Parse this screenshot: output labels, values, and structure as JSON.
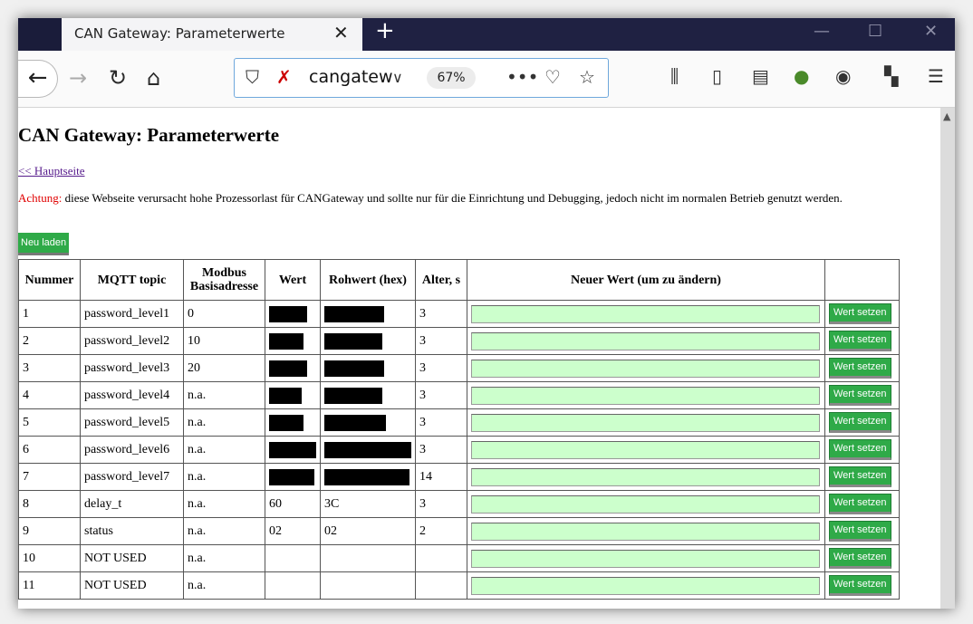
{
  "browser": {
    "tab_title": "CAN Gateway: Parameterwerte",
    "tab_close": "✕",
    "new_tab": "+",
    "url": "cangatew",
    "zoom": "67%",
    "icons": [
      "back-icon",
      "forward-icon",
      "reload-icon",
      "home-icon",
      "shield-icon",
      "tracking-off-icon",
      "dropdown-icon",
      "more-icon",
      "pocket-icon",
      "bookmark-star-icon",
      "library-icon",
      "sidebar-icon",
      "reader-icon",
      "extension-icon",
      "account-icon",
      "gift-icon",
      "menu-icon"
    ]
  },
  "page": {
    "title": "CAN Gateway: Parameterwerte",
    "home_link": "<< Hauptseite",
    "warning_label": "Achtung:",
    "warning_text": " diese Webseite verursacht hohe Prozessorlast für CANGateway und sollte nur für die Einrichtung und Debugging, jedoch nicht im normalen Betrieb genutzt werden.",
    "reload_button": "Neu laden",
    "set_button": "Wert setzen",
    "table": {
      "headers": [
        "Nummer",
        "MQTT topic",
        "Modbus Basisadresse",
        "Wert",
        "Rohwert (hex)",
        "Alter, s",
        "Neuer Wert (um zu ändern)",
        ""
      ],
      "rows": [
        {
          "nr": "1",
          "topic": "password_level1",
          "modbus": "0",
          "wert": "",
          "raw": "",
          "alter": "3",
          "wert_redacted": true,
          "raw_redacted": true
        },
        {
          "nr": "2",
          "topic": "password_level2",
          "modbus": "10",
          "wert": "",
          "raw": "",
          "alter": "3",
          "wert_redacted": true,
          "raw_redacted": true
        },
        {
          "nr": "3",
          "topic": "password_level3",
          "modbus": "20",
          "wert": "",
          "raw": "",
          "alter": "3",
          "wert_redacted": true,
          "raw_redacted": true
        },
        {
          "nr": "4",
          "topic": "password_level4",
          "modbus": "n.a.",
          "wert": "",
          "raw": "",
          "alter": "3",
          "wert_redacted": true,
          "raw_redacted": true
        },
        {
          "nr": "5",
          "topic": "password_level5",
          "modbus": "n.a.",
          "wert": "",
          "raw": "",
          "alter": "3",
          "wert_redacted": true,
          "raw_redacted": true
        },
        {
          "nr": "6",
          "topic": "password_level6",
          "modbus": "n.a.",
          "wert": "",
          "raw": "",
          "alter": "3",
          "wert_redacted": true,
          "raw_redacted": true
        },
        {
          "nr": "7",
          "topic": "password_level7",
          "modbus": "n.a.",
          "wert": "",
          "raw": "",
          "alter": "14",
          "wert_redacted": true,
          "raw_redacted": true
        },
        {
          "nr": "8",
          "topic": "delay_t",
          "modbus": "n.a.",
          "wert": "60",
          "raw": "3C",
          "alter": "3",
          "wert_redacted": false,
          "raw_redacted": false
        },
        {
          "nr": "9",
          "topic": "status",
          "modbus": "n.a.",
          "wert": "02",
          "raw": "02",
          "alter": "2",
          "wert_redacted": false,
          "raw_redacted": false
        },
        {
          "nr": "10",
          "topic": "NOT USED",
          "modbus": "n.a.",
          "wert": "",
          "raw": "",
          "alter": "",
          "wert_redacted": false,
          "raw_redacted": false
        },
        {
          "nr": "11",
          "topic": "NOT USED",
          "modbus": "n.a.",
          "wert": "",
          "raw": "",
          "alter": "",
          "wert_redacted": false,
          "raw_redacted": false
        }
      ]
    }
  }
}
